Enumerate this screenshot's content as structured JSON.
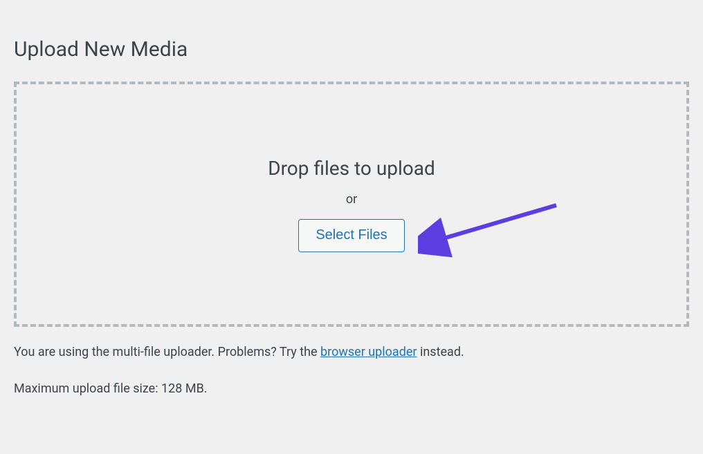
{
  "page": {
    "title": "Upload New Media"
  },
  "dropzone": {
    "drop_label": "Drop files to upload",
    "or_label": "or",
    "select_label": "Select Files"
  },
  "hints": {
    "multi_pre": "You are using the multi-file uploader. Problems? Try the ",
    "browser_link": "browser uploader",
    "multi_post": " instead.",
    "max_size": "Maximum upload file size: 128 MB."
  },
  "annotation": {
    "arrow_color": "#5a3ee0"
  }
}
